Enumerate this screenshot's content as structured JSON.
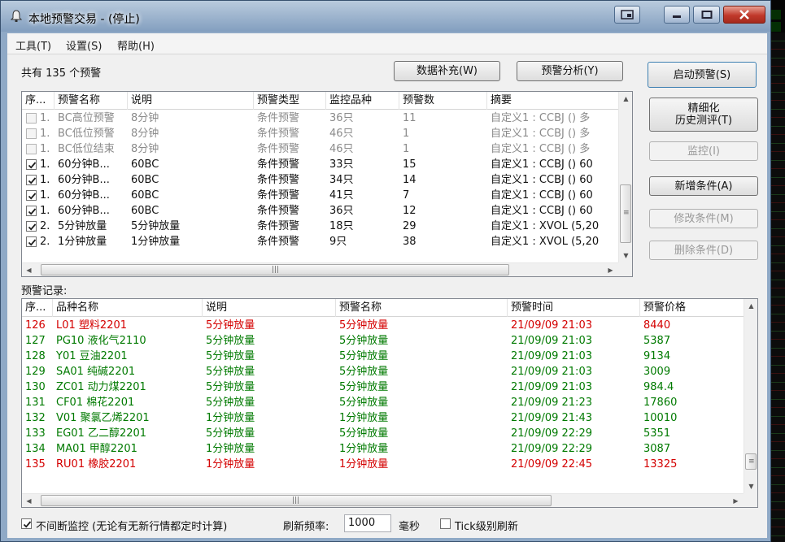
{
  "window": {
    "title": "本地预警交易 - (停止)",
    "menu": [
      "工具(T)",
      "设置(S)",
      "帮助(H)"
    ]
  },
  "alerts": {
    "count_prefix": "共有",
    "count": "135",
    "count_suffix": "个预警",
    "columns": [
      "序...",
      "预警名称",
      "说明",
      "预警类型",
      "监控品种",
      "预警数",
      "摘要"
    ],
    "rows": [
      {
        "checked": false,
        "seq": "1.",
        "name": "BC高位预警",
        "desc": "8分钟",
        "type": "条件预警",
        "symbols": "36只",
        "count": "11",
        "summary": "自定义1 : CCBJ () 多",
        "enabled": false
      },
      {
        "checked": false,
        "seq": "1.",
        "name": "BC低位预警",
        "desc": "8分钟",
        "type": "条件预警",
        "symbols": "46只",
        "count": "1",
        "summary": "自定义1 : CCBJ () 多",
        "enabled": false
      },
      {
        "checked": false,
        "seq": "1.",
        "name": "BC低位结束",
        "desc": "8分钟",
        "type": "条件预警",
        "symbols": "46只",
        "count": "1",
        "summary": "自定义1 : CCBJ () 多",
        "enabled": false
      },
      {
        "checked": true,
        "seq": "1.",
        "name": "60分钟B...",
        "desc": "60BC",
        "type": "条件预警",
        "symbols": "33只",
        "count": "15",
        "summary": "自定义1 : CCBJ () 60",
        "enabled": true
      },
      {
        "checked": true,
        "seq": "1.",
        "name": "60分钟B...",
        "desc": "60BC",
        "type": "条件预警",
        "symbols": "34只",
        "count": "14",
        "summary": "自定义1 : CCBJ () 60",
        "enabled": true
      },
      {
        "checked": true,
        "seq": "1.",
        "name": "60分钟B...",
        "desc": "60BC",
        "type": "条件预警",
        "symbols": "41只",
        "count": "7",
        "summary": "自定义1 : CCBJ () 60",
        "enabled": true
      },
      {
        "checked": true,
        "seq": "1.",
        "name": "60分钟B...",
        "desc": "60BC",
        "type": "条件预警",
        "symbols": "36只",
        "count": "12",
        "summary": "自定义1 : CCBJ () 60",
        "enabled": true
      },
      {
        "checked": true,
        "seq": "2.",
        "name": "5分钟放量",
        "desc": "5分钟放量",
        "type": "条件预警",
        "symbols": "18只",
        "count": "29",
        "summary": "自定义1 : XVOL (5,20",
        "enabled": true
      },
      {
        "checked": true,
        "seq": "2.",
        "name": "1分钟放量",
        "desc": "1分钟放量",
        "type": "条件预警",
        "symbols": "9只",
        "count": "38",
        "summary": "自定义1 : XVOL (5,20",
        "enabled": true
      }
    ]
  },
  "buttons": {
    "data_supplement": "数据补充(W)",
    "alert_analysis": "预警分析(Y)",
    "start_alert": "启动预警(S)",
    "backtest_line1": "精细化",
    "backtest_line2": "历史测评(T)",
    "monitor": "监控(I)",
    "add_condition": "新增条件(A)",
    "modify_condition": "修改条件(M)",
    "delete_condition": "删除条件(D)"
  },
  "records": {
    "title": "预警记录:",
    "columns": [
      "序...",
      "品种名称",
      "说明",
      "预警名称",
      "预警时间",
      "预警价格"
    ],
    "rows": [
      {
        "seq": "126",
        "symbol": "L01 塑料2201",
        "desc": "5分钟放量",
        "alert": "5分钟放量",
        "time": "21/09/09 21:03",
        "price": "8440",
        "color": "red"
      },
      {
        "seq": "127",
        "symbol": "PG10 液化气2110",
        "desc": "5分钟放量",
        "alert": "5分钟放量",
        "time": "21/09/09 21:03",
        "price": "5387",
        "color": "green"
      },
      {
        "seq": "128",
        "symbol": "Y01 豆油2201",
        "desc": "5分钟放量",
        "alert": "5分钟放量",
        "time": "21/09/09 21:03",
        "price": "9134",
        "color": "green"
      },
      {
        "seq": "129",
        "symbol": "SA01 纯碱2201",
        "desc": "5分钟放量",
        "alert": "5分钟放量",
        "time": "21/09/09 21:03",
        "price": "3009",
        "color": "green"
      },
      {
        "seq": "130",
        "symbol": "ZC01 动力煤2201",
        "desc": "5分钟放量",
        "alert": "5分钟放量",
        "time": "21/09/09 21:03",
        "price": "984.4",
        "color": "green"
      },
      {
        "seq": "131",
        "symbol": "CF01 棉花2201",
        "desc": "5分钟放量",
        "alert": "5分钟放量",
        "time": "21/09/09 21:23",
        "price": "17860",
        "color": "green"
      },
      {
        "seq": "132",
        "symbol": "V01 聚氯乙烯2201",
        "desc": "1分钟放量",
        "alert": "1分钟放量",
        "time": "21/09/09 21:43",
        "price": "10010",
        "color": "green"
      },
      {
        "seq": "133",
        "symbol": "EG01 乙二醇2201",
        "desc": "5分钟放量",
        "alert": "5分钟放量",
        "time": "21/09/09 22:29",
        "price": "5351",
        "color": "green"
      },
      {
        "seq": "134",
        "symbol": "MA01 甲醇2201",
        "desc": "1分钟放量",
        "alert": "1分钟放量",
        "time": "21/09/09 22:29",
        "price": "3087",
        "color": "green"
      },
      {
        "seq": "135",
        "symbol": "RU01 橡胶2201",
        "desc": "1分钟放量",
        "alert": "1分钟放量",
        "time": "21/09/09 22:45",
        "price": "13325",
        "color": "red"
      }
    ]
  },
  "footer": {
    "continuous_label": "不间断监控 (无论有无新行情都定时计算)",
    "continuous_checked": true,
    "refresh_label": "刷新频率:",
    "refresh_value": "1000",
    "refresh_unit": "毫秒",
    "tick_label": "Tick级别刷新",
    "tick_checked": false
  },
  "colors": {
    "alarm_red": "#d40000",
    "alarm_green": "#007a00",
    "disabled_text": "#8a8a8a"
  }
}
